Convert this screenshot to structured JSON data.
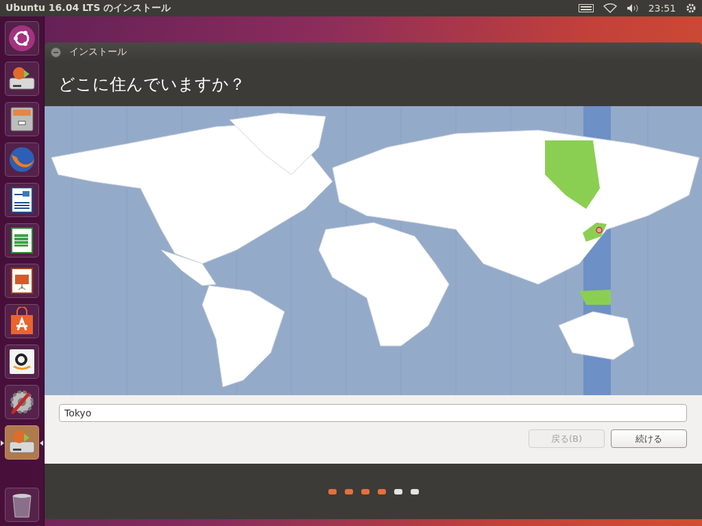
{
  "top_bar": {
    "title": "Ubuntu 16.04 LTS のインストール",
    "time": "23:51"
  },
  "launcher": [
    {
      "kind": "ubuntu",
      "selected": false
    },
    {
      "kind": "installer",
      "selected": false
    },
    {
      "kind": "files",
      "selected": false
    },
    {
      "kind": "browser",
      "selected": false
    },
    {
      "kind": "writer",
      "selected": false
    },
    {
      "kind": "calc",
      "selected": false
    },
    {
      "kind": "impress",
      "selected": false
    },
    {
      "kind": "store",
      "selected": false
    },
    {
      "kind": "amazon",
      "selected": false
    },
    {
      "kind": "settings",
      "selected": false
    },
    {
      "kind": "installer",
      "selected": true
    },
    {
      "kind": "trash",
      "selected": false
    }
  ],
  "window": {
    "title": "インストール",
    "heading": "どこに住んでいますか？"
  },
  "location_field": {
    "value": "Tokyo"
  },
  "buttons": [
    {
      "label": "戻る(B)",
      "disabled": true
    },
    {
      "label": "続ける",
      "disabled": false
    }
  ],
  "progress_steps": [
    {
      "done": true
    },
    {
      "done": true
    },
    {
      "done": true
    },
    {
      "done": true
    },
    {
      "done": false
    },
    {
      "done": false
    }
  ]
}
